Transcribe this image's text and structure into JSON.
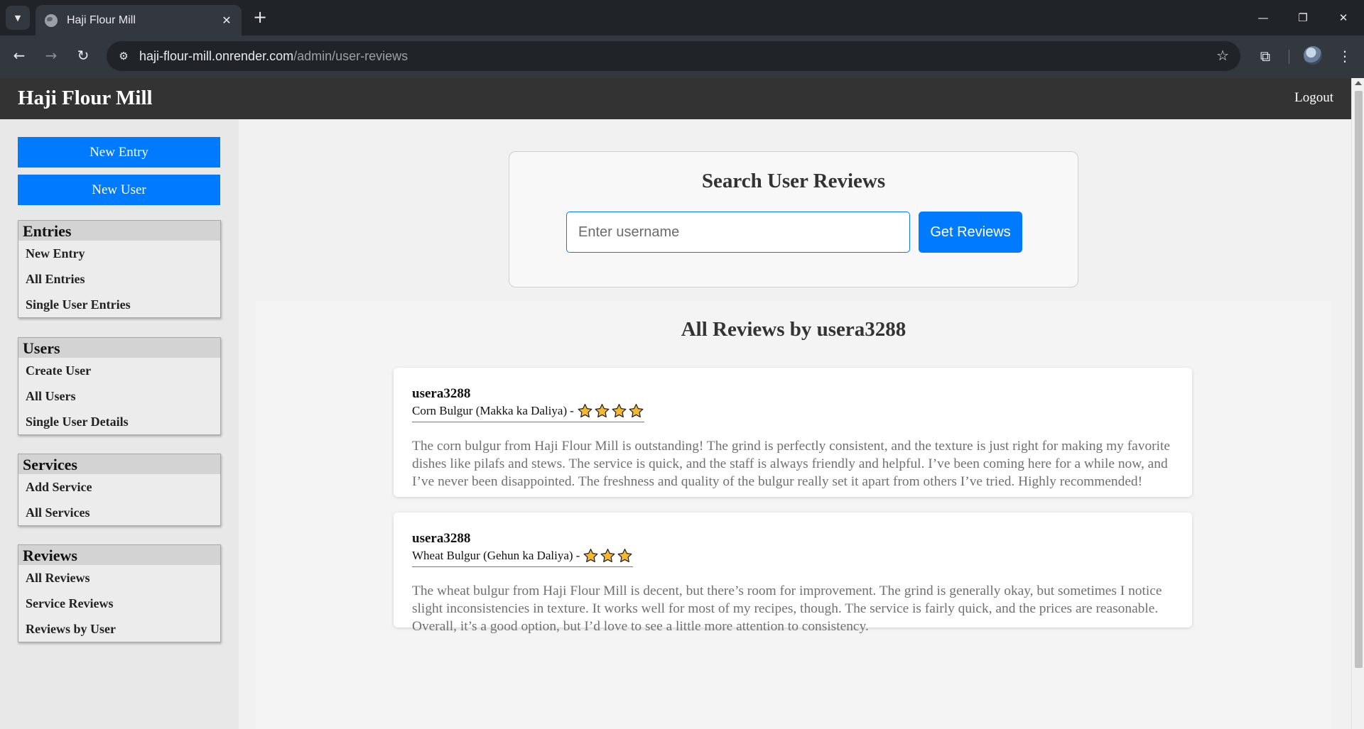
{
  "browser": {
    "tab_title": "Haji Flour Mill",
    "url_host": "haji-flour-mill.onrender.com",
    "url_path": "/admin/user-reviews"
  },
  "header": {
    "title": "Haji Flour Mill",
    "logout_label": "Logout"
  },
  "sidebar": {
    "buttons": [
      "New Entry",
      "New User"
    ],
    "groups": [
      {
        "title": "Entries",
        "items": [
          "New Entry",
          "All Entries",
          "Single User Entries"
        ]
      },
      {
        "title": "Users",
        "items": [
          "Create User",
          "All Users",
          "Single User Details"
        ]
      },
      {
        "title": "Services",
        "items": [
          "Add Service",
          "All Services"
        ]
      },
      {
        "title": "Reviews",
        "items": [
          "All Reviews",
          "Service Reviews",
          "Reviews by User"
        ]
      }
    ]
  },
  "search": {
    "title": "Search User Reviews",
    "placeholder": "Enter username",
    "value": "",
    "button_label": "Get Reviews"
  },
  "results": {
    "title": "All Reviews by usera3288",
    "reviews": [
      {
        "username": "usera3288",
        "service": "Corn Bulgur (Makka ka Daliya)",
        "separator": "-",
        "rating": 4,
        "text": "The corn bulgur from Haji Flour Mill is outstanding! The grind is perfectly consistent, and the texture is just right for making my favorite dishes like pilafs and stews. The service is quick, and the staff is always friendly and helpful. I’ve been coming here for a while now, and I’ve never been disappointed. The freshness and quality of the bulgur really set it apart from others I’ve tried. Highly recommended!"
      },
      {
        "username": "usera3288",
        "service": "Wheat Bulgur (Gehun ka Daliya)",
        "separator": "-",
        "rating": 3,
        "text": "The wheat bulgur from Haji Flour Mill is decent, but there’s room for improvement. The grind is generally okay, but sometimes I notice slight inconsistencies in texture. It works well for most of my recipes, though. The service is fairly quick, and the prices are reasonable. Overall, it’s a good option, but I’d love to see a little more attention to consistency."
      }
    ]
  },
  "colors": {
    "accent": "#007bff",
    "header_bg": "#333333",
    "star_fill": "#f5b82e"
  }
}
